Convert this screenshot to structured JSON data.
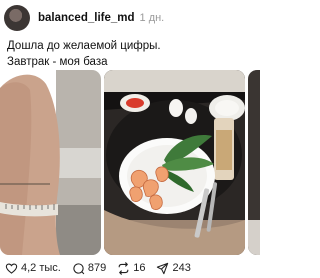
{
  "post": {
    "username": "balanced_life_md",
    "time": "1 дн.",
    "caption_line1": "Дошла до желаемой цифры.",
    "caption_line2": "Завтрак - моя база"
  },
  "media": [
    {
      "name": "leg-measuring-tape-photo"
    },
    {
      "name": "breakfast-plate-photo"
    },
    {
      "name": "partial-third-photo"
    }
  ],
  "actions": {
    "likes": "4,2 тыс.",
    "comments": "879",
    "reposts": "16",
    "shares": "243"
  },
  "icons": {
    "like": "heart-icon",
    "comment": "comment-bubble-icon",
    "repost": "repost-icon",
    "share": "share-icon"
  }
}
